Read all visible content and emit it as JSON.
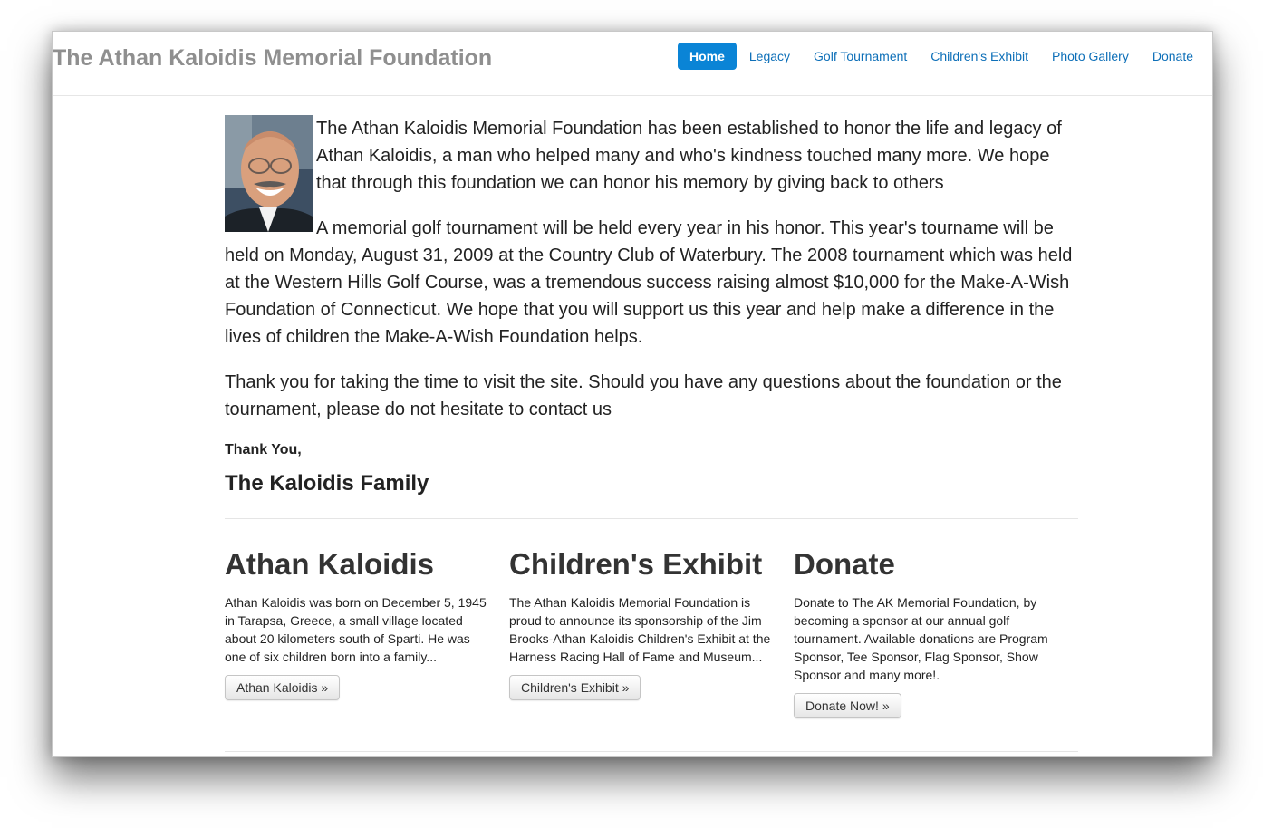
{
  "header": {
    "brand": "The Athan Kaloidis Memorial Foundation",
    "nav": [
      {
        "label": "Home",
        "active": true
      },
      {
        "label": "Legacy"
      },
      {
        "label": "Golf Tournament"
      },
      {
        "label": "Children's Exhibit"
      },
      {
        "label": "Photo Gallery"
      },
      {
        "label": "Donate"
      }
    ]
  },
  "intro": {
    "paragraph1": "The Athan Kaloidis Memorial Foundation has been established to honor the life and legacy of Athan Kaloidis, a man who helped many and who's kindness touched many more. We hope that through this foundation we can honor his memory by giving back to others",
    "paragraph2": "A memorial golf tournament will be held every year in his honor. This year's tourname will be held on Monday, August 31, 2009 at the Country Club of Waterbury. The 2008 tournament which was held at the Western Hills Golf Course, was a tremendous success raising almost $10,000 for the Make-A-Wish Foundation of Connecticut. We hope that you will support us this year and help make a difference in the lives of children the Make-A-Wish Foundation helps.",
    "paragraph3": "Thank you for taking the time to visit the site. Should you have any questions about the foundation or the tournament, please do not hesitate to contact us",
    "thank_you": "Thank You,",
    "signature": "The Kaloidis Family"
  },
  "columns": [
    {
      "title": "Athan Kaloidis",
      "text": "Athan Kaloidis was born on December 5, 1945 in Tarapsa, Greece, a small village located about 20 kilometers south of Sparti. He was one of six children born into a family...",
      "button": "Athan Kaloidis »"
    },
    {
      "title": "Children's Exhibit",
      "text": "The Athan Kaloidis Memorial Foundation is proud to announce its sponsorship of the Jim Brooks-Athan Kaloidis Children's Exhibit at the Harness Racing Hall of Fame and Museum...",
      "button": "Children's Exhibit »"
    },
    {
      "title": "Donate",
      "text": "Donate to The AK Memorial Foundation, by becoming a sponsor at our annual golf tournament. Available donations are Program Sponsor, Tee Sponsor, Flag Sponsor, Show Sponsor and many more!.",
      "button": "Donate Now! »"
    }
  ],
  "colors": {
    "brand": "#8f8f8f",
    "link": "#0d6fb8",
    "active_nav": "#0a84d6"
  }
}
